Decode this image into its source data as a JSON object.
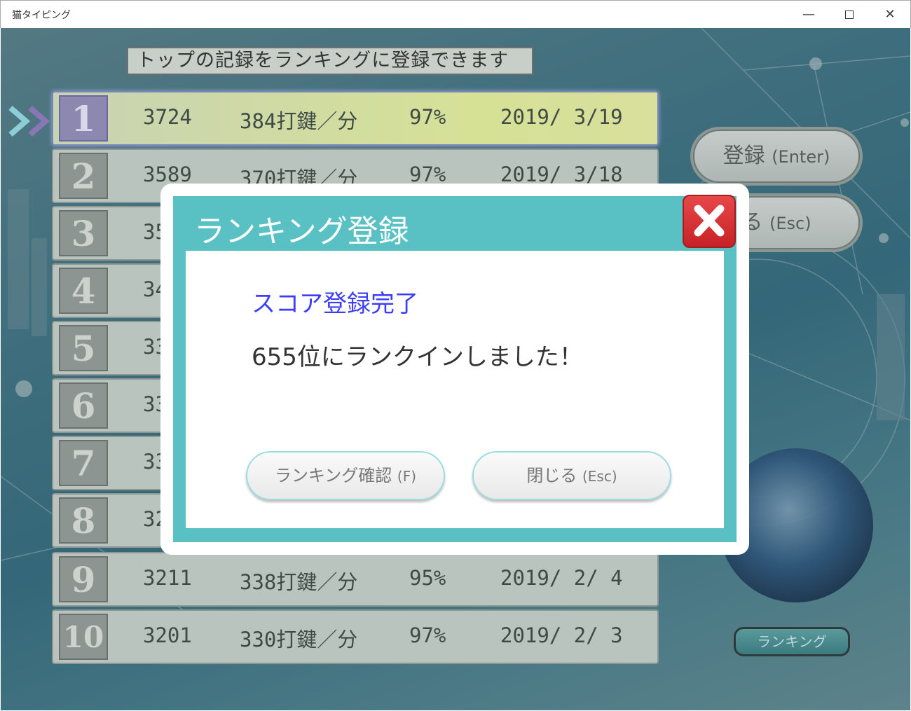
{
  "window": {
    "title": "猫タイピング",
    "minimize_glyph": "—",
    "close_glyph": "✕"
  },
  "screen": {
    "heading": "トップの記録をランキングに登録できます",
    "ranking": [
      {
        "rank": "1",
        "score": "3724",
        "speed": "384打鍵／分",
        "accuracy": "97%",
        "date": "2019/ 3/19"
      },
      {
        "rank": "2",
        "score": "3589",
        "speed": "370打鍵／分",
        "accuracy": "97%",
        "date": "2019/ 3/18"
      },
      {
        "rank": "3",
        "score": "35",
        "speed": "",
        "accuracy": "",
        "date": ""
      },
      {
        "rank": "4",
        "score": "34",
        "speed": "",
        "accuracy": "",
        "date": ""
      },
      {
        "rank": "5",
        "score": "33",
        "speed": "",
        "accuracy": "",
        "date": ""
      },
      {
        "rank": "6",
        "score": "33",
        "speed": "",
        "accuracy": "",
        "date": ""
      },
      {
        "rank": "7",
        "score": "33",
        "speed": "",
        "accuracy": "",
        "date": ""
      },
      {
        "rank": "8",
        "score": "32",
        "speed": "",
        "accuracy": "",
        "date": ""
      },
      {
        "rank": "9",
        "score": "3211",
        "speed": "338打鍵／分",
        "accuracy": "95%",
        "date": "2019/ 2/ 4"
      },
      {
        "rank": "10",
        "score": "3201",
        "speed": "330打鍵／分",
        "accuracy": "97%",
        "date": "2019/ 2/ 3"
      }
    ],
    "register_button": {
      "label": "登録",
      "key": "(Enter)"
    },
    "close_button": {
      "label": "る",
      "key": "(Esc)"
    },
    "ranking_button": "ランキング"
  },
  "dialog": {
    "title": "ランキング登録",
    "heading": "スコア登録完了",
    "message": "655位にランクインしました！",
    "confirm_button": {
      "label": "ランキング確認",
      "key": "(F)"
    },
    "close_button": {
      "label": "閉じる",
      "key": "(Esc)"
    },
    "colors": {
      "frame": "#59c1c3",
      "heading": "#3c3cff",
      "close": "#e03b3f"
    }
  }
}
